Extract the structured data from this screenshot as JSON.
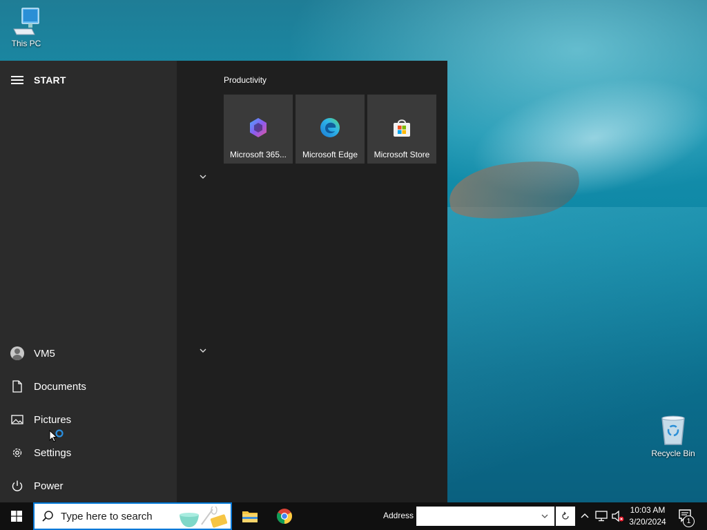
{
  "desktop": {
    "icons": [
      {
        "label": "This PC",
        "icon": "computer-icon"
      },
      {
        "label": "Recycle Bin",
        "icon": "recycle-bin-icon"
      }
    ]
  },
  "start_menu": {
    "title": "START",
    "nav": {
      "user": "VM5",
      "documents": "Documents",
      "pictures": "Pictures",
      "settings": "Settings",
      "power": "Power"
    },
    "group": {
      "title": "Productivity",
      "tiles": [
        {
          "label": "Microsoft 365...",
          "icon": "microsoft-365-icon"
        },
        {
          "label": "Microsoft Edge",
          "icon": "edge-icon"
        },
        {
          "label": "Microsoft Store",
          "icon": "store-icon"
        }
      ]
    }
  },
  "taskbar": {
    "search_placeholder": "Type here to search",
    "address_label": "Address",
    "address_value": "",
    "apps": [
      "file-explorer-icon",
      "chrome-icon"
    ],
    "clock": {
      "time": "10:03 AM",
      "date": "3/20/2024"
    },
    "notification_count": "1"
  },
  "colors": {
    "accent": "#0078d7",
    "start_bg": "#1f1f1f",
    "nav_bg": "#2b2b2b",
    "tile_bg": "#3a3a3a",
    "taskbar_bg": "#101010"
  }
}
